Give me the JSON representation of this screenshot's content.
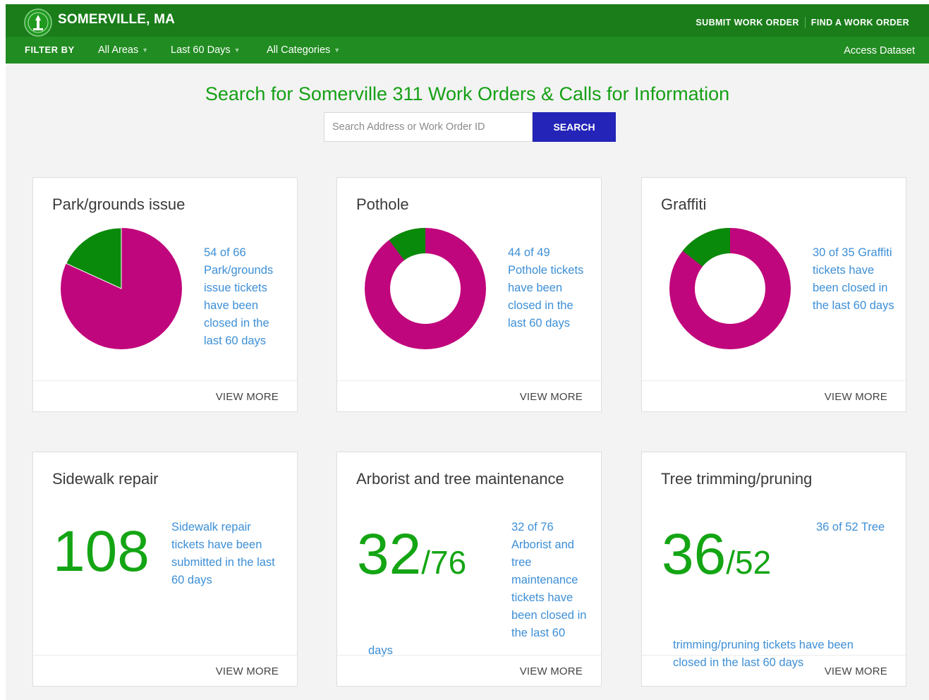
{
  "header": {
    "city": "SOMERVILLE, MA",
    "links": [
      "SUBMIT WORK ORDER",
      "FIND A WORK ORDER"
    ]
  },
  "filter": {
    "label": "FILTER BY",
    "options": [
      "All Areas",
      "Last 60 Days",
      "All Categories"
    ],
    "dataset_link": "Access Dataset"
  },
  "search": {
    "title": "Search for Somerville 311 Work Orders & Calls for Information",
    "placeholder": "Search Address or Work Order ID",
    "button": "SEARCH"
  },
  "colors": {
    "closed": "#c0067c",
    "open": "#0a8a0a",
    "accent": "#14a514"
  },
  "view_more": "VIEW MORE",
  "cards": [
    {
      "title": "Park/grounds issue",
      "type": "pie",
      "closed": 54,
      "total": 66,
      "desc": "54 of 66 Park/grounds issue tickets have been closed in the last 60 days"
    },
    {
      "title": "Pothole",
      "type": "donut",
      "closed": 44,
      "total": 49,
      "desc": "44 of 49 Pothole tickets have been closed in the last 60 days"
    },
    {
      "title": "Graffiti",
      "type": "donut",
      "closed": 30,
      "total": 35,
      "desc": "30 of 35 Graffiti tickets have been closed in the last 60 days"
    },
    {
      "title": "Sidewalk repair",
      "type": "count",
      "value": "108",
      "desc": "Sidewalk repair tickets have been submitted in the last 60 days"
    },
    {
      "title": "Arborist and tree maintenance",
      "type": "ratio",
      "closed": "32",
      "total": "/76",
      "desc": "32 of 76 Arborist and tree maintenance tickets have been closed in the last 60",
      "tail": "days"
    },
    {
      "title": "Tree trimming/pruning",
      "type": "ratio",
      "closed": "36",
      "total": "/52",
      "desc": "36 of 52 Tree",
      "tail": "trimming/pruning tickets have been closed in the last 60 days"
    }
  ]
}
